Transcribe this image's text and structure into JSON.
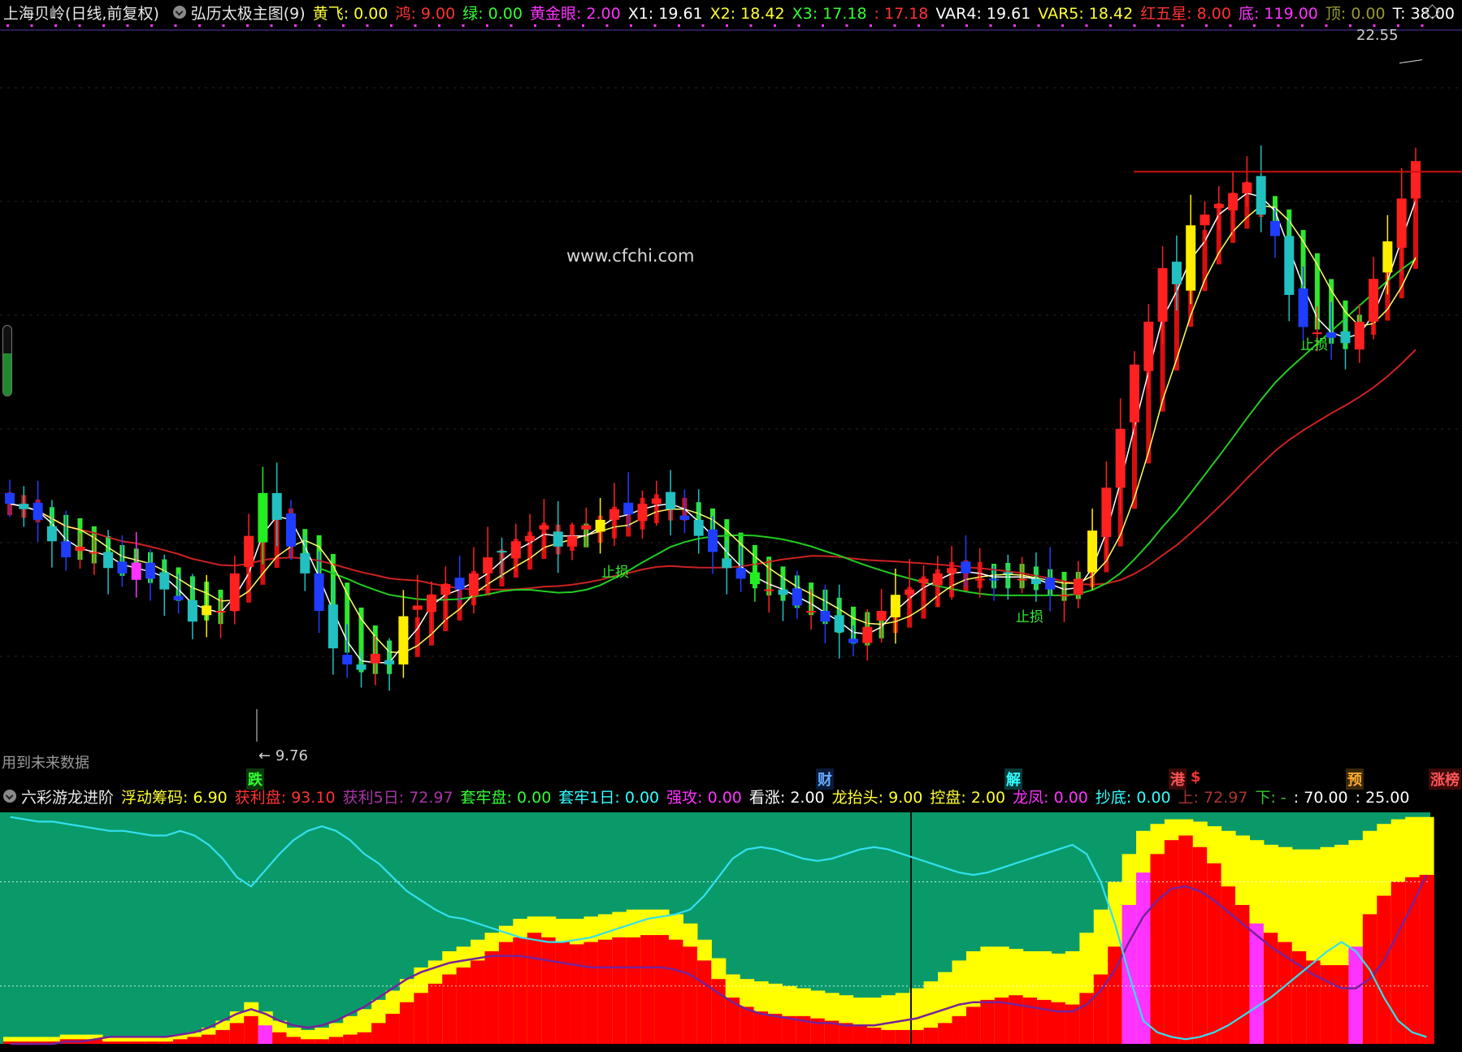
{
  "header": {
    "stock": "上海贝岭(日线,前复权)",
    "indicator": "弘历太极主图(9)",
    "values": [
      {
        "label": "黄飞: 0.00",
        "color": "#ffff33"
      },
      {
        "label": "鸿: 9.00",
        "color": "#ff3333"
      },
      {
        "label": "绿: 0.00",
        "color": "#33ff33"
      },
      {
        "label": "黄金眼: 2.00",
        "color": "#ff33ff"
      },
      {
        "label": "X1: 19.61",
        "color": "#ffffff"
      },
      {
        "label": "X2: 18.42",
        "color": "#ffff33"
      },
      {
        "label": "X3: 17.18",
        "color": "#33ff33"
      },
      {
        "label": ": 17.18",
        "color": "#ff3333"
      },
      {
        "label": "VAR4: 19.61",
        "color": "#ffffff"
      },
      {
        "label": "VAR5: 18.42",
        "color": "#ffff33"
      },
      {
        "label": "红五星: 8.00",
        "color": "#ff3333"
      },
      {
        "label": "底: 119.00",
        "color": "#ff33ff"
      },
      {
        "label": "顶: 0.00",
        "color": "#999933"
      },
      {
        "label": "T: 38.00",
        "color": "#ffffff"
      }
    ]
  },
  "watermark": "www.cfchi.com",
  "future_note": "用到未来数据",
  "high_label": "22.55",
  "low_label": "9.76",
  "chart_marks": {
    "stop_loss": "止损"
  },
  "events": [
    {
      "label": "跌",
      "color": "#33ff33",
      "bg": "#0a3a0a"
    },
    {
      "label": "财",
      "color": "#66aaff",
      "bg": "#0a1a3a"
    },
    {
      "label": "解",
      "color": "#33ffff",
      "bg": "#0a3a3a"
    },
    {
      "label": "港",
      "color": "#ff5555",
      "bg": "#3a0a0a"
    },
    {
      "label": "$",
      "color": "#ff3333",
      "bg": "transparent"
    },
    {
      "label": "预",
      "color": "#ffaa33",
      "bg": "#3a2a0a"
    },
    {
      "label": "涨榜",
      "color": "#ff5555",
      "bg": "#3a0a0a"
    }
  ],
  "subheader": {
    "indicator": "六彩游龙进阶",
    "values": [
      {
        "label": "浮动筹码: 6.90",
        "color": "#ffff33"
      },
      {
        "label": "获利盘: 93.10",
        "color": "#ff3333"
      },
      {
        "label": "获利5日: 72.97",
        "color": "#aa33aa"
      },
      {
        "label": "套牢盘: 0.00",
        "color": "#33ff33"
      },
      {
        "label": "套牢1日: 0.00",
        "color": "#33ffff"
      },
      {
        "label": "强攻: 0.00",
        "color": "#ff33ff"
      },
      {
        "label": "看涨: 2.00",
        "color": "#ffffff"
      },
      {
        "label": "龙抬头: 9.00",
        "color": "#ffff33"
      },
      {
        "label": "控盘: 2.00",
        "color": "#ffff33"
      },
      {
        "label": "龙凤: 0.00",
        "color": "#ff33ff"
      },
      {
        "label": "抄底: 0.00",
        "color": "#33ffff"
      },
      {
        "label": "上: 72.97",
        "color": "#aa3333"
      },
      {
        "label": "下: -",
        "color": "#33cc33"
      },
      {
        "label": ": 70.00",
        "color": "#ffffff"
      },
      {
        "label": ": 25.00",
        "color": "#ffffff"
      }
    ]
  },
  "colors": {
    "up": "#ff2020",
    "down_blue": "#1f3dff",
    "down_cyan": "#22c0c0",
    "doji_yellow": "#ffee00",
    "green_bar": "#22ee22",
    "magenta": "#ff33ff",
    "ma_red": "#cc2222",
    "ma_green": "#22cc22",
    "white_line": "#ffffff",
    "ribbon_yellow": "#ffff66",
    "sub_bg": "#0a9a6a",
    "sub_red": "#ff0000",
    "sub_yellow": "#ffff00",
    "sub_cyan": "#33e0ee",
    "sub_purple": "#772299"
  },
  "chart_data": [
    {
      "type": "candlestick",
      "title": "",
      "ylim": [
        9.5,
        23.0
      ],
      "price_levels": [
        22.55,
        9.76
      ],
      "series": [
        {
          "values": [
            14.2,
            14.1,
            13.9,
            13.5,
            13.2,
            13.4,
            13.3,
            13.0,
            12.9,
            13.1,
            12.8,
            12.6,
            12.4,
            12.0,
            12.3,
            12.2,
            12.9,
            13.6,
            14.4,
            13.9,
            13.4,
            12.9,
            12.2,
            11.5,
            11.2,
            11.1,
            11.4,
            11.2,
            12.1,
            12.3,
            12.5,
            12.7,
            12.6,
            12.9,
            13.2,
            13.3,
            13.5,
            13.6,
            13.8,
            13.4,
            13.6,
            13.8,
            13.9,
            14.1,
            14.0,
            14.2,
            14.3,
            14.1,
            13.9,
            13.6,
            13.3,
            13.0,
            12.8,
            12.7,
            12.6,
            12.5,
            12.3,
            12.2,
            12.0,
            11.8,
            11.6,
            11.9,
            12.2,
            12.5,
            12.6,
            12.8,
            12.9,
            13.0,
            12.9,
            12.8,
            12.8,
            12.9,
            12.8,
            12.7,
            12.6,
            12.5,
            12.8,
            13.7,
            14.5,
            15.6,
            16.8,
            17.6,
            18.6,
            18.3,
            19.4,
            19.6,
            19.8,
            20.0,
            20.2,
            19.6,
            19.2,
            18.1,
            17.5,
            17.4,
            17.3,
            17.2,
            17.6,
            18.4,
            19.1,
            19.9,
            20.6
          ]
        }
      ]
    },
    {
      "type": "area",
      "title": "",
      "ylim": [
        0,
        100
      ],
      "levels": [
        70,
        25
      ],
      "x": "101 trading days",
      "series": [
        {
          "name": "获利盘",
          "values": [
            1,
            1,
            1,
            1,
            2,
            2,
            2,
            1,
            1,
            1,
            1,
            1,
            2,
            3,
            4,
            6,
            9,
            12,
            8,
            5,
            3,
            2,
            2,
            3,
            4,
            5,
            9,
            13,
            18,
            22,
            26,
            30,
            33,
            36,
            40,
            44,
            46,
            48,
            46,
            44,
            43,
            44,
            45,
            46,
            46,
            47,
            47,
            45,
            42,
            36,
            28,
            20,
            16,
            14,
            13,
            12,
            12,
            11,
            10,
            9,
            8,
            7,
            6,
            6,
            6,
            7,
            9,
            12,
            16,
            19,
            20,
            21,
            20,
            19,
            18,
            17,
            22,
            30,
            42,
            60,
            74,
            82,
            88,
            90,
            85,
            78,
            68,
            60,
            52,
            48,
            44,
            40,
            36,
            34,
            34,
            42,
            56,
            64,
            70,
            72,
            73
          ]
        },
        {
          "name": "浮动筹码",
          "values": [
            3,
            3,
            3,
            3,
            4,
            4,
            4,
            3,
            3,
            3,
            3,
            3,
            4,
            5,
            7,
            10,
            14,
            18,
            14,
            10,
            7,
            6,
            7,
            9,
            12,
            15,
            19,
            23,
            28,
            33,
            36,
            40,
            42,
            45,
            48,
            51,
            54,
            55,
            55,
            54,
            54,
            55,
            56,
            57,
            58,
            58,
            58,
            56,
            52,
            45,
            37,
            30,
            28,
            27,
            26,
            25,
            24,
            23,
            22,
            21,
            20,
            20,
            21,
            22,
            24,
            27,
            31,
            36,
            40,
            42,
            42,
            41,
            40,
            40,
            39,
            40,
            48,
            58,
            70,
            82,
            92,
            95,
            97,
            97,
            96,
            94,
            92,
            90,
            88,
            86,
            85,
            84,
            84,
            85,
            86,
            88,
            92,
            95,
            97,
            98,
            98
          ]
        },
        {
          "name": "获利5日",
          "values": [
            0,
            0,
            0,
            0,
            1,
            1,
            2,
            3,
            3,
            3,
            3,
            3,
            4,
            5,
            7,
            10,
            13,
            15,
            13,
            10,
            8,
            7,
            8,
            10,
            13,
            16,
            20,
            24,
            28,
            31,
            33,
            35,
            36,
            37,
            38,
            38,
            38,
            37,
            36,
            35,
            34,
            33,
            33,
            33,
            33,
            33,
            33,
            32,
            30,
            26,
            22,
            18,
            15,
            13,
            12,
            11,
            10,
            9,
            9,
            8,
            8,
            8,
            9,
            10,
            11,
            13,
            15,
            17,
            18,
            18,
            18,
            17,
            16,
            15,
            14,
            14,
            17,
            23,
            32,
            44,
            55,
            62,
            67,
            68,
            66,
            62,
            57,
            52,
            47,
            42,
            38,
            34,
            30,
            27,
            24,
            24,
            28,
            36,
            48,
            60,
            73
          ]
        },
        {
          "name": "套牢1日",
          "values": [
            98,
            97,
            96,
            96,
            95,
            94,
            93,
            92,
            92,
            91,
            90,
            90,
            92,
            90,
            86,
            80,
            72,
            68,
            75,
            82,
            88,
            92,
            94,
            92,
            88,
            82,
            78,
            72,
            66,
            62,
            58,
            55,
            54,
            52,
            50,
            48,
            46,
            45,
            44,
            44,
            45,
            46,
            48,
            50,
            52,
            54,
            55,
            56,
            58,
            64,
            72,
            80,
            84,
            85,
            84,
            82,
            80,
            79,
            80,
            82,
            84,
            85,
            84,
            82,
            80,
            78,
            76,
            74,
            73,
            74,
            76,
            78,
            80,
            82,
            84,
            86,
            82,
            70,
            52,
            30,
            10,
            5,
            3,
            2,
            3,
            5,
            8,
            12,
            16,
            20,
            25,
            30,
            35,
            40,
            44,
            40,
            32,
            20,
            10,
            5,
            3
          ]
        }
      ]
    }
  ]
}
